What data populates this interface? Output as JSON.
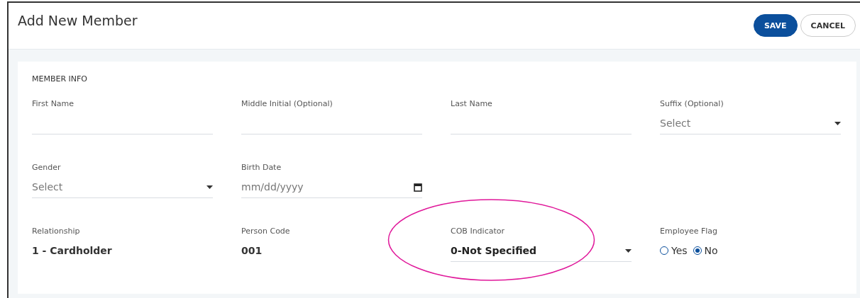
{
  "window": {
    "title": "Add New Member"
  },
  "buttons": [
    {
      "label": "SAVE",
      "kind": "primary"
    },
    {
      "label": "CANCEL",
      "kind": "secondary"
    }
  ],
  "section": {
    "title": "MEMBER INFO",
    "rows": [
      [
        {
          "label": "First Name",
          "kind": "text"
        },
        {
          "label": "Middle Initial (Optional)",
          "kind": "text"
        },
        {
          "label": "Last Name",
          "kind": "text"
        },
        {
          "label": "Suffix (Optional)",
          "kind": "select",
          "placeholder": "Select"
        }
      ],
      [
        {
          "label": "Gender",
          "kind": "select",
          "placeholder": "Select"
        },
        {
          "label": "Birth Date",
          "kind": "date",
          "placeholder": "mm/dd/yyyy"
        }
      ],
      [
        {
          "label": "Relationship",
          "kind": "static",
          "value": "1 - Cardholder"
        },
        {
          "label": "Person Code",
          "kind": "static",
          "value": "001"
        },
        {
          "label": "COB Indicator",
          "kind": "select",
          "value": "0-Not Specified",
          "highlighted": true
        },
        {
          "label": "Employee Flag",
          "kind": "radio",
          "options": [
            {
              "label": "Yes",
              "selected": false
            },
            {
              "label": "No",
              "selected": true
            }
          ]
        }
      ]
    ]
  }
}
